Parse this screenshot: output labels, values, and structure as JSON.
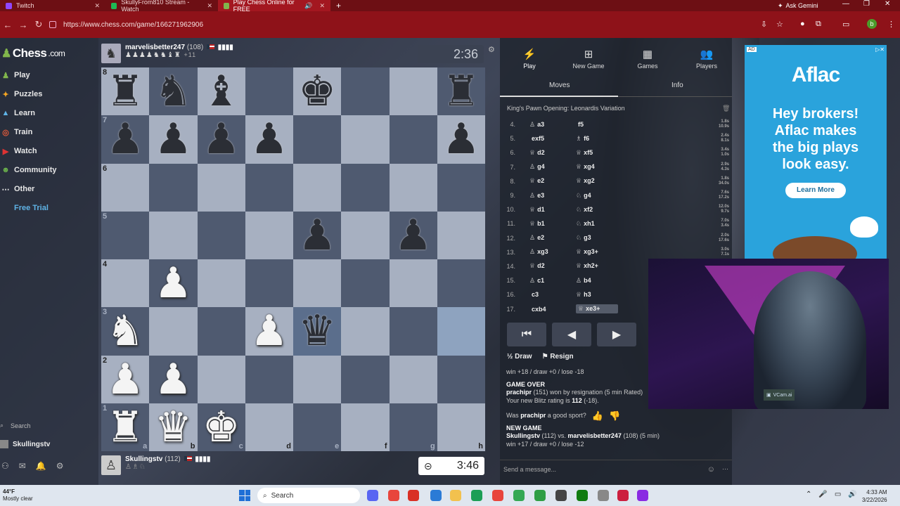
{
  "browser": {
    "tabs": [
      {
        "label": "Twitch",
        "color": "#9146ff"
      },
      {
        "label": "SkullyFrom810 Stream - Watch",
        "color": "#1db954"
      },
      {
        "label": "Play Chess Online for FREE",
        "color": "#81b64c"
      }
    ],
    "new_tab": "+",
    "ask_gemini": "Ask Gemini",
    "url": "https://www.chess.com/game/166271962906",
    "profile_initial": "b"
  },
  "site": {
    "logo": "Chess",
    "logo_suffix": ".com",
    "nav": [
      {
        "label": "Play",
        "icon": "♟"
      },
      {
        "label": "Puzzles",
        "icon": "✦"
      },
      {
        "label": "Learn",
        "icon": "▲"
      },
      {
        "label": "Train",
        "icon": "◎"
      },
      {
        "label": "Watch",
        "icon": "▶"
      },
      {
        "label": "Community",
        "icon": "☻"
      },
      {
        "label": "Other",
        "icon": "⋯"
      },
      {
        "label": "Free Trial",
        "icon": ""
      }
    ],
    "search_label": "Search",
    "username": "Skullingstv"
  },
  "top_player": {
    "name": "marvelisbetter247",
    "rating": "(108)",
    "captured": "♟♟♟♟♞♞♝♜",
    "advantage": "+11"
  },
  "bottom_player": {
    "name": "Skullingstv",
    "rating": "(112)",
    "captured": "♙♗♘"
  },
  "clock_top": "2:36",
  "clock_bottom": "3:46",
  "board": {
    "ranks": [
      "8",
      "7",
      "6",
      "5",
      "4",
      "3",
      "2",
      "1"
    ],
    "files": [
      "a",
      "b",
      "c",
      "d",
      "e",
      "f",
      "g",
      "h"
    ],
    "position": [
      [
        "bR",
        "bN",
        "bB",
        "",
        "bK",
        "",
        "",
        "bR"
      ],
      [
        "bP",
        "bP",
        "bP",
        "bP",
        "",
        "",
        "",
        "bP"
      ],
      [
        "",
        "",
        "",
        "",
        "",
        "",
        "",
        ""
      ],
      [
        "",
        "",
        "",
        "",
        "bP",
        "",
        "bP",
        ""
      ],
      [
        "",
        "wP",
        "",
        "",
        "",
        "",
        "",
        ""
      ],
      [
        "wN",
        "",
        "",
        "wP",
        "bQ",
        "",
        "",
        ""
      ],
      [
        "wP",
        "wP",
        "",
        "",
        "",
        "",
        "",
        ""
      ],
      [
        "wR",
        "wQ",
        "wK",
        "",
        "",
        "",
        "",
        ""
      ]
    ],
    "highlight": [
      "e3",
      "h3"
    ]
  },
  "panel": {
    "tabs": [
      {
        "label": "Play",
        "icon": "⚡"
      },
      {
        "label": "New Game",
        "icon": "⊞"
      },
      {
        "label": "Games",
        "icon": "▦"
      },
      {
        "label": "Players",
        "icon": "👥"
      }
    ],
    "subtabs": [
      "Moves",
      "Info"
    ],
    "opening": "King's Pawn Opening: Leonardis Variation",
    "moves": [
      {
        "n": "4.",
        "wp": "♙",
        "w": "a3",
        "bp": "",
        "b": "f5",
        "t": [
          "1.8s",
          "10.9s"
        ]
      },
      {
        "n": "5.",
        "wp": "",
        "w": "exf5",
        "bp": "♗",
        "b": "f6",
        "t": [
          "2.4s",
          "8.1s"
        ]
      },
      {
        "n": "6.",
        "wp": "♕",
        "w": "d2",
        "bp": "♕",
        "b": "xf5",
        "t": [
          "3.4s",
          "1.0s"
        ]
      },
      {
        "n": "7.",
        "wp": "♙",
        "w": "g4",
        "bp": "♕",
        "b": "xg4",
        "t": [
          "2.9s",
          "4.3s"
        ]
      },
      {
        "n": "8.",
        "wp": "♕",
        "w": "e2",
        "bp": "♕",
        "b": "xg2",
        "t": [
          "1.8s",
          "34.0s"
        ]
      },
      {
        "n": "9.",
        "wp": "♙",
        "w": "e3",
        "bp": "♘",
        "b": "g4",
        "t": [
          "7.6s",
          "17.2s"
        ]
      },
      {
        "n": "10.",
        "wp": "♕",
        "w": "d1",
        "bp": "♘",
        "b": "xf2",
        "t": [
          "12.0s",
          "9.7s"
        ]
      },
      {
        "n": "11.",
        "wp": "♕",
        "w": "b1",
        "bp": "♘",
        "b": "xh1",
        "t": [
          "7.0s",
          "3.4s"
        ]
      },
      {
        "n": "12.",
        "wp": "♙",
        "w": "e2",
        "bp": "♘",
        "b": "g3",
        "t": [
          "2.0s",
          "17.6s"
        ]
      },
      {
        "n": "13.",
        "wp": "♙",
        "w": "xg3",
        "bp": "♕",
        "b": "xg3+",
        "t": [
          "3.0s",
          "7.1s"
        ]
      },
      {
        "n": "14.",
        "wp": "♕",
        "w": "d2",
        "bp": "♕",
        "b": "xh2+",
        "t": [
          "",
          ""
        ]
      },
      {
        "n": "15.",
        "wp": "♙",
        "w": "c1",
        "bp": "♙",
        "b": "b4",
        "t": [
          "",
          ""
        ]
      },
      {
        "n": "16.",
        "wp": "",
        "w": "c3",
        "bp": "♕",
        "b": "h3",
        "t": [
          "",
          ""
        ]
      },
      {
        "n": "17.",
        "wp": "",
        "w": "cxb4",
        "bp": "♕",
        "b": "xe3+",
        "t": [
          "",
          ""
        ]
      }
    ],
    "controls": [
      "⏮",
      "◀",
      "▶"
    ],
    "draw": "Draw",
    "resign": "Resign",
    "draw_icon": "½",
    "record1": "win +18 / draw +0 / lose -18",
    "game_over_title": "GAME OVER",
    "game_over_text_a": "prachipr",
    "game_over_text_b": "(151) won by resignation (5 min Rated)",
    "rating_text_a": "Your new Blitz rating is",
    "rating_text_b": "112",
    "rating_text_c": "(-18).",
    "sport_question_a": "Was",
    "sport_question_b": "prachipr",
    "sport_question_c": "a good sport?",
    "new_game_title": "NEW GAME",
    "new_game_a": "Skullingstv",
    "new_game_b": "(112) vs.",
    "new_game_c": "marvelisbetter247",
    "new_game_d": "(108) (5 min)",
    "record2": "win +17 / draw +0 / lose -12",
    "message_placeholder": "Send a message..."
  },
  "ad": {
    "badge": "AD",
    "logo": "Aflac",
    "headline_lines": [
      "Hey brokers!",
      "Aflac makes",
      "the big plays",
      "look easy."
    ],
    "cta": "Learn More",
    "brand_color": "#2aa3dc"
  },
  "webcam": {
    "label": "VCam.ai"
  },
  "taskbar": {
    "temp": "44°F",
    "weather": "Mostly clear",
    "search": "Search",
    "time": "4:33 AM",
    "date": "3/22/2026"
  },
  "colors": {
    "accent_red": "#8e1219",
    "board_light": "#a7b0c1",
    "board_dark": "#4f5a70",
    "trial_blue": "#5fb3e6"
  }
}
